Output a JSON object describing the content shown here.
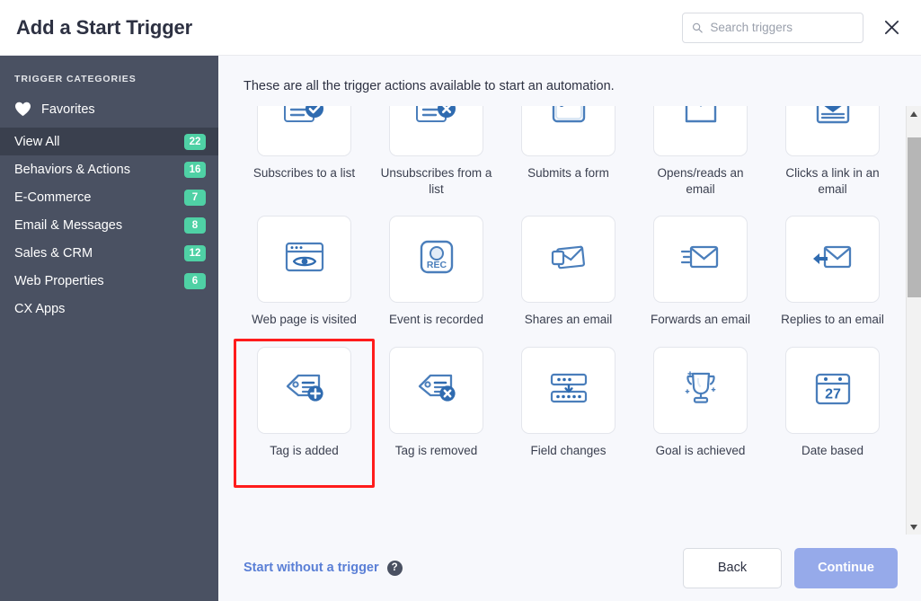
{
  "header": {
    "title": "Add a Start Trigger",
    "search_placeholder": "Search triggers",
    "search_value": "",
    "search_icon": "search-icon",
    "close_icon": "close-icon"
  },
  "sidebar": {
    "heading": "TRIGGER CATEGORIES",
    "favorites": {
      "label": "Favorites",
      "icon": "heart-icon"
    },
    "items": [
      {
        "label": "View All",
        "badge": "22",
        "active": true
      },
      {
        "label": "Behaviors & Actions",
        "badge": "16",
        "active": false
      },
      {
        "label": "E-Commerce",
        "badge": "7",
        "active": false
      },
      {
        "label": "Email & Messages",
        "badge": "8",
        "active": false
      },
      {
        "label": "Sales & CRM",
        "badge": "12",
        "active": false
      },
      {
        "label": "Web Properties",
        "badge": "6",
        "active": false
      },
      {
        "label": "CX Apps",
        "badge": "",
        "active": false
      }
    ],
    "colors": {
      "background": "#4a5162",
      "active_background": "#3a404e",
      "badge": "#4fd1a5"
    }
  },
  "main": {
    "intro": "These are all the trigger actions available to start an automation.",
    "triggers": [
      {
        "label": "Subscribes to a list",
        "icon": "list-check-icon",
        "selected": false
      },
      {
        "label": "Unsubscribes from a list",
        "icon": "list-x-icon",
        "selected": false
      },
      {
        "label": "Submits a form",
        "icon": "form-icon",
        "selected": false
      },
      {
        "label": "Opens/reads an email",
        "icon": "envelope-open-icon",
        "selected": false
      },
      {
        "label": "Clicks a link in an email",
        "icon": "envelope-click-icon",
        "selected": false
      },
      {
        "label": "Web page is visited",
        "icon": "browser-eye-icon",
        "selected": false
      },
      {
        "label": "Event is recorded",
        "icon": "rec-button-icon",
        "selected": false
      },
      {
        "label": "Shares an email",
        "icon": "envelope-share-icon",
        "selected": false
      },
      {
        "label": "Forwards an email",
        "icon": "envelope-forward-icon",
        "selected": false
      },
      {
        "label": "Replies to an email",
        "icon": "envelope-reply-icon",
        "selected": false
      },
      {
        "label": "Tag is added",
        "icon": "tag-plus-icon",
        "selected": true
      },
      {
        "label": "Tag is removed",
        "icon": "tag-x-icon",
        "selected": false
      },
      {
        "label": "Field changes",
        "icon": "field-change-icon",
        "selected": false
      },
      {
        "label": "Goal is achieved",
        "icon": "trophy-icon",
        "selected": false
      },
      {
        "label": "Date based",
        "icon": "calendar-icon",
        "selected": false
      }
    ],
    "calendar_day": "27",
    "rec_label": "REC",
    "selection_highlight_color": "#ff1c1c"
  },
  "footer": {
    "start_without_trigger": "Start without a trigger",
    "help_icon_glyph": "?",
    "back_label": "Back",
    "continue_label": "Continue",
    "continue_color": "#96aaea"
  }
}
